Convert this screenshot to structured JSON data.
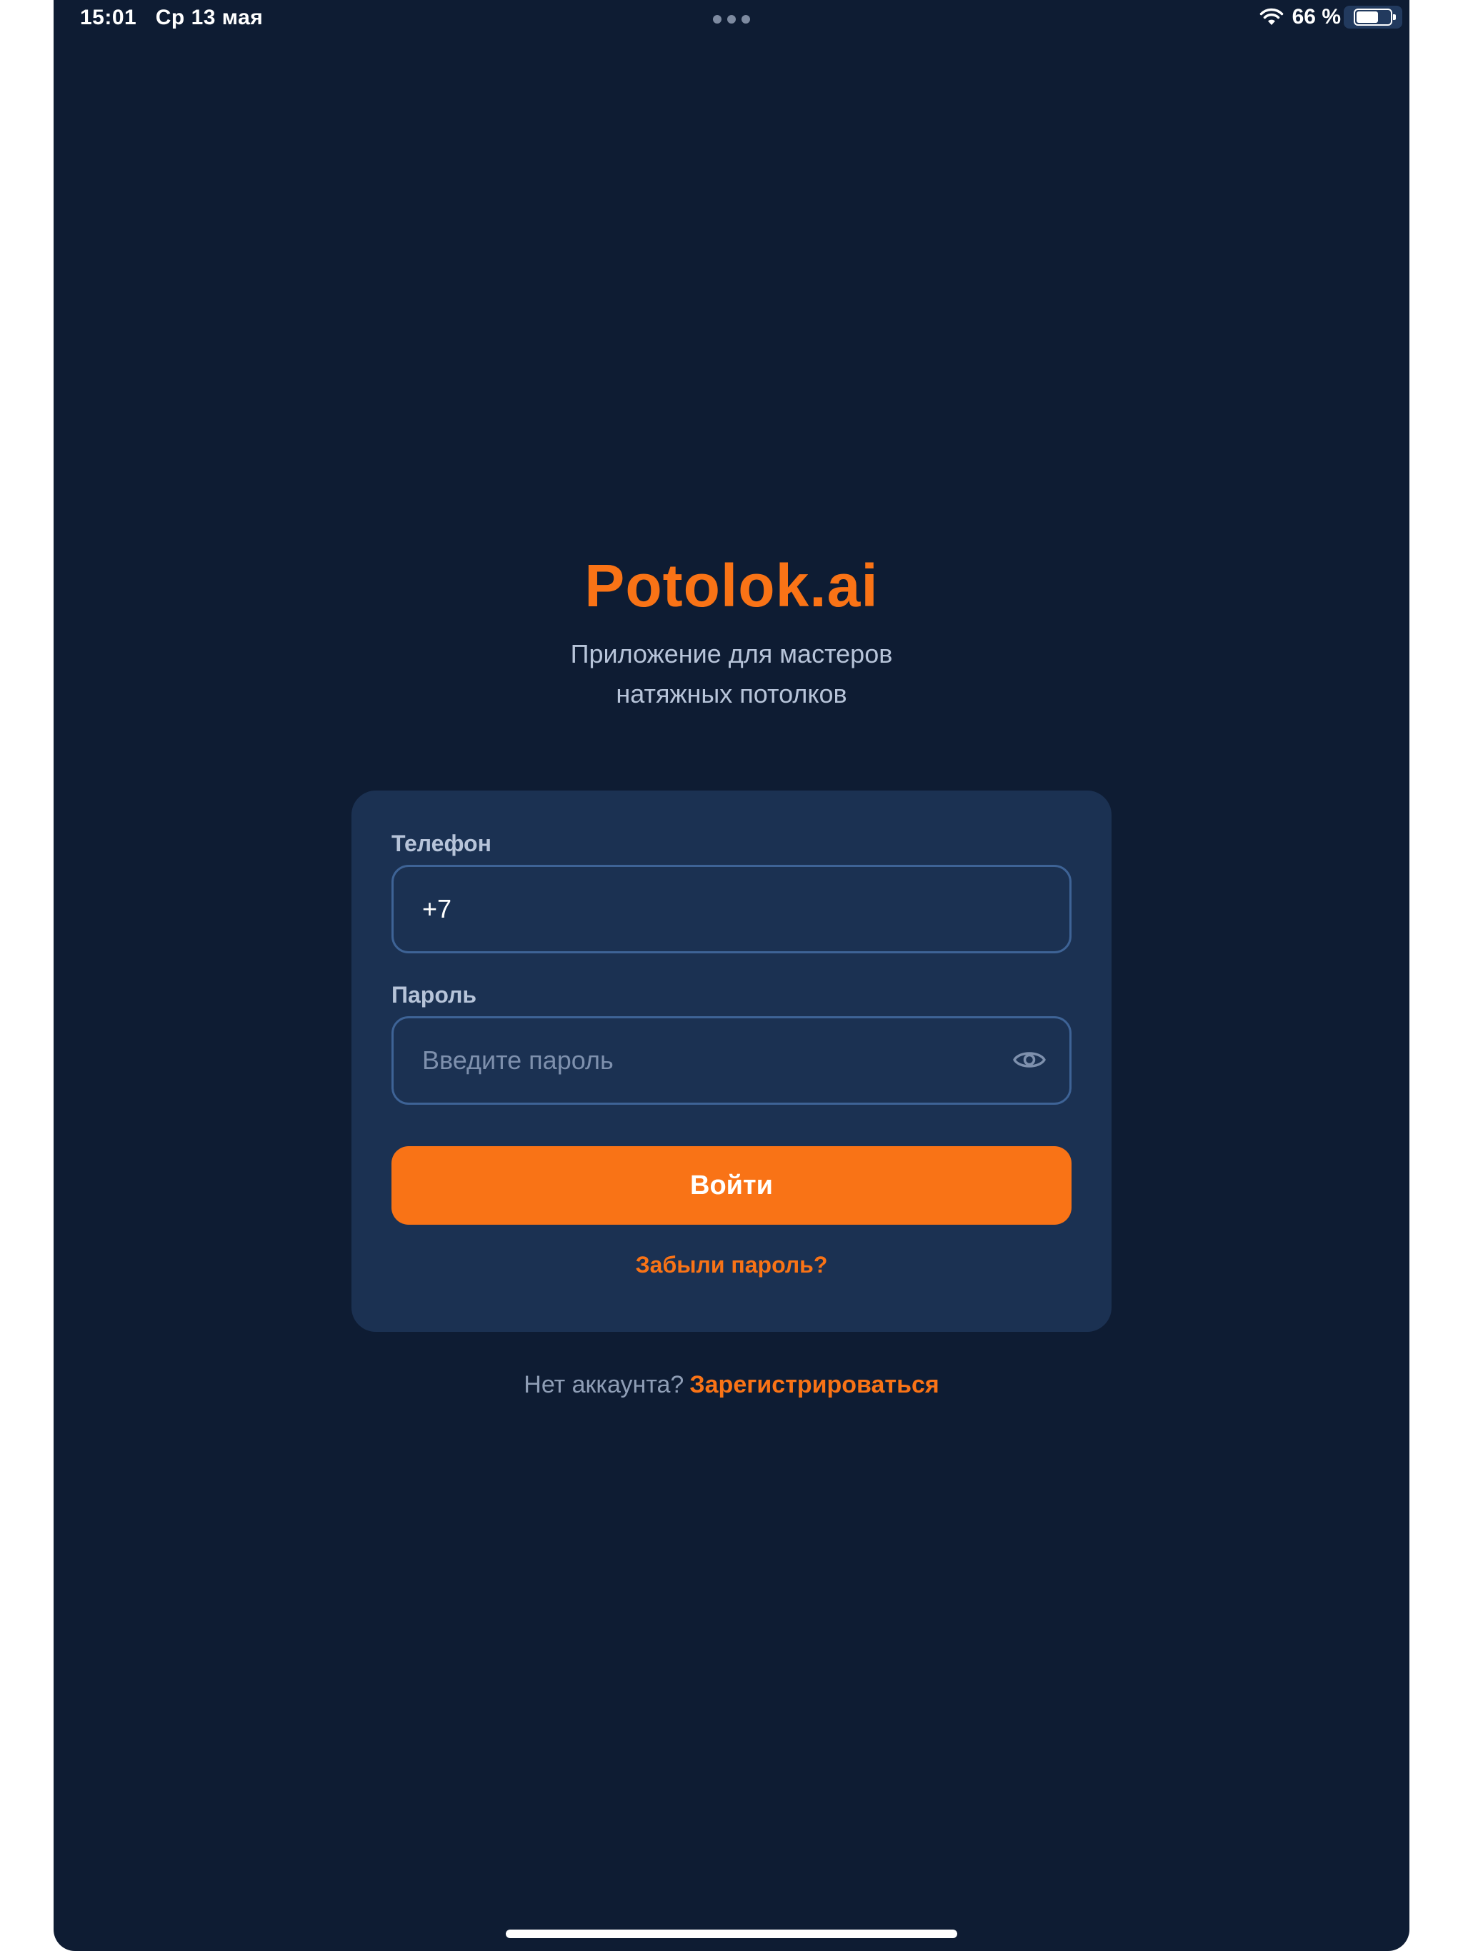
{
  "status_bar": {
    "time": "15:01",
    "date": "Ср 13 мая",
    "battery_percent": "66 %",
    "battery_level": 0.66,
    "icons": [
      "wifi-icon",
      "battery-icon"
    ]
  },
  "brand": {
    "title": "Potolok.ai",
    "subtitle_line1": "Приложение для мастеров",
    "subtitle_line2": "натяжных потолков"
  },
  "form": {
    "phone": {
      "label": "Телефон",
      "value": "+7"
    },
    "password": {
      "label": "Пароль",
      "placeholder": "Введите пароль",
      "toggle_icon": "eye-icon"
    },
    "submit_label": "Войти",
    "forgot_label": "Забыли пароль?"
  },
  "register": {
    "prompt": "Нет аккаунта?",
    "link_label": "Зарегистрироваться"
  },
  "colors": {
    "background": "#0e1c33",
    "card": "#1b3152",
    "accent": "#f97316",
    "input_border": "#3e6396",
    "muted_text": "#b7c4d9"
  }
}
